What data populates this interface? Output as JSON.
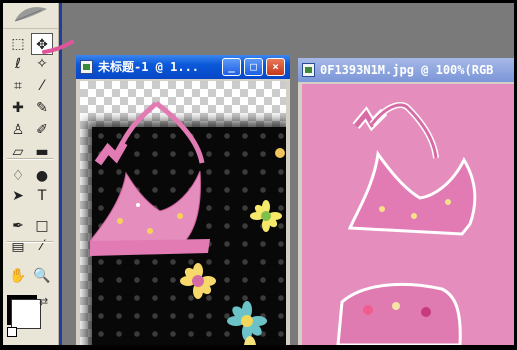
{
  "toolbox": {
    "tools": [
      {
        "name": "rectangular-marquee-tool",
        "glyph": "⬚"
      },
      {
        "name": "move-tool",
        "glyph": "✥"
      },
      {
        "name": "lasso-tool",
        "glyph": "ℓ"
      },
      {
        "name": "magic-wand-tool",
        "glyph": "✧"
      },
      {
        "name": "crop-tool",
        "glyph": "⌗"
      },
      {
        "name": "slice-tool",
        "glyph": "⁄"
      },
      {
        "name": "healing-brush-tool",
        "glyph": "✚"
      },
      {
        "name": "brush-tool",
        "glyph": "✎"
      },
      {
        "name": "clone-stamp-tool",
        "glyph": "♙"
      },
      {
        "name": "history-brush-tool",
        "glyph": "✐"
      },
      {
        "name": "eraser-tool",
        "glyph": "▱"
      },
      {
        "name": "gradient-tool",
        "glyph": "▬"
      },
      {
        "name": "blur-tool",
        "glyph": "♢"
      },
      {
        "name": "dodge-tool",
        "glyph": "●"
      },
      {
        "name": "path-selection-tool",
        "glyph": "➤"
      },
      {
        "name": "type-tool",
        "glyph": "T"
      },
      {
        "name": "pen-tool",
        "glyph": "✒"
      },
      {
        "name": "shape-tool",
        "glyph": "□"
      },
      {
        "name": "notes-tool",
        "glyph": "▤"
      },
      {
        "name": "eyedropper-tool",
        "glyph": "⁄"
      },
      {
        "name": "hand-tool",
        "glyph": "✋"
      },
      {
        "name": "zoom-tool",
        "glyph": "🔍"
      }
    ],
    "foreground_color": "#ffffff",
    "background_color": "#000000"
  },
  "windows": [
    {
      "title": "未标题-1 @ 1...",
      "state": "active",
      "buttons": {
        "minimize": "_",
        "maximize": "□",
        "close": "×"
      }
    },
    {
      "title": "0F1393N1M.jpg @ 100%(RGB",
      "state": "inactive"
    }
  ],
  "colors": {
    "accent": "#e0559a",
    "titlebar_active": "#0a58d8",
    "canvas_pink": "#e58ebd",
    "bikini_pink": "#e27bb4"
  }
}
